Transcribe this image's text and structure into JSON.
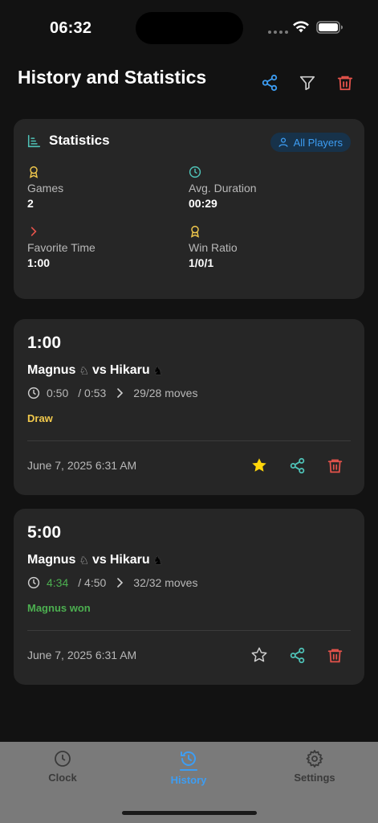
{
  "status": {
    "time": "06:32"
  },
  "header": {
    "title": "History and Statistics"
  },
  "stats": {
    "title": "Statistics",
    "filter_label": "All Players",
    "games_label": "Games",
    "games_value": "2",
    "duration_label": "Avg. Duration",
    "duration_value": "00:29",
    "fav_label": "Favorite Time",
    "fav_value": "1:00",
    "ratio_label": "Win Ratio",
    "ratio_value": "1/0/1"
  },
  "games": [
    {
      "time_control": "1:00",
      "white": "Magnus",
      "vs": "vs",
      "black": "Hikaru",
      "white_time": "0:50",
      "black_time": "/ 0:53",
      "moves": "29/28 moves",
      "result": "Draw",
      "date": "June 7, 2025 6:31 AM",
      "starred": true
    },
    {
      "time_control": "5:00",
      "white": "Magnus",
      "vs": "vs",
      "black": "Hikaru",
      "white_time": "4:34",
      "black_time": "/ 4:50",
      "moves": "32/32 moves",
      "result": "Magnus won",
      "date": "June 7, 2025 6:31 AM",
      "starred": false
    }
  ],
  "tabs": [
    {
      "label": "Clock",
      "icon": "clock-icon"
    },
    {
      "label": "History",
      "icon": "history-icon"
    },
    {
      "label": "Settings",
      "icon": "gear-icon"
    }
  ],
  "colors": {
    "accent": "#3d9df3",
    "teal": "#4fc3b8",
    "gold": "#f2c94c",
    "danger": "#e5534b",
    "win": "#4caf50"
  }
}
